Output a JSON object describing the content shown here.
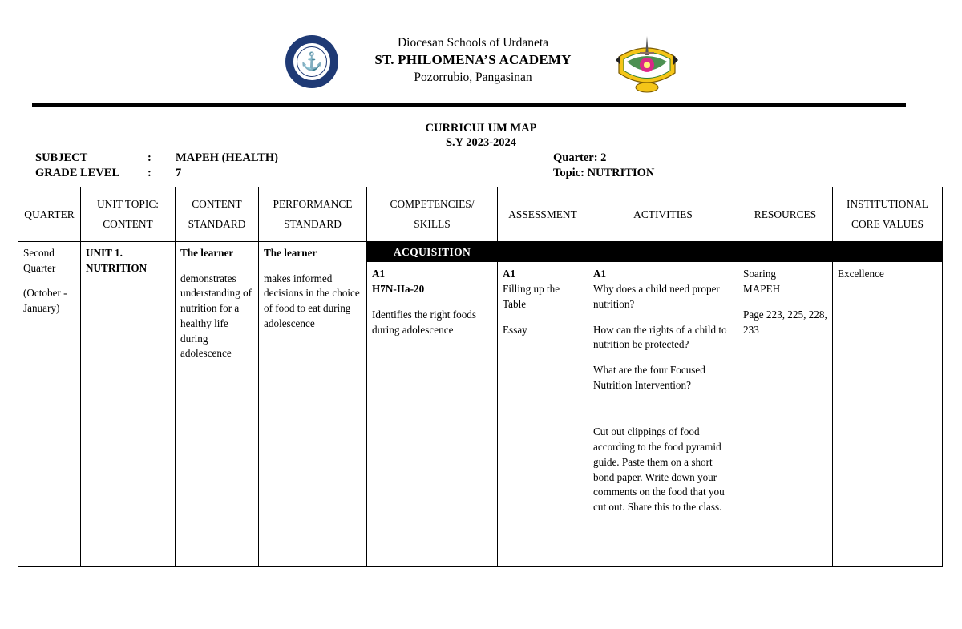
{
  "letterhead": {
    "line1": "Diocesan Schools of Urdaneta",
    "line2": "ST. PHILOMENA’S ACADEMY",
    "line3": "Pozorrubio, Pangasinan",
    "left_seal_name": "st-philomenas-academy-seal",
    "right_seal_name": "diocesan-schools-of-urdaneta-seal"
  },
  "title": {
    "line1": "CURRICULUM MAP",
    "line2": "S.Y 2023-2024"
  },
  "meta": {
    "subject_label": "SUBJECT",
    "subject_colon": ":",
    "subject_value": "MAPEH (HEALTH)",
    "grade_label": "GRADE LEVEL",
    "grade_colon": ":",
    "grade_value": "7",
    "quarter": "Quarter: 2",
    "topic": "Topic: NUTRITION"
  },
  "table": {
    "headers": [
      {
        "top": "QUARTER",
        "bottom": ""
      },
      {
        "top": "UNIT TOPIC:",
        "bottom": "CONTENT"
      },
      {
        "top": "CONTENT",
        "bottom": "STANDARD"
      },
      {
        "top": "PERFORMANCE",
        "bottom": "STANDARD"
      },
      {
        "top": "COMPETENCIES/",
        "bottom": "SKILLS"
      },
      {
        "top": "ASSESSMENT",
        "bottom": ""
      },
      {
        "top": "ACTIVITIES",
        "bottom": ""
      },
      {
        "top": "RESOURCES",
        "bottom": ""
      },
      {
        "top": "INSTITUTIONAL",
        "bottom": "CORE VALUES"
      }
    ],
    "band_label": "ACQUISITION",
    "row": {
      "quarter_line1": "Second",
      "quarter_line2": "Quarter",
      "quarter_line3": "(October -",
      "quarter_line4": "January)",
      "unit_line1": "UNIT 1.",
      "unit_line2": "NUTRITION",
      "content_standard_head": "The learner",
      "content_standard_body": "demonstrates understanding of nutrition for a healthy life during adolescence",
      "performance_standard_head": "The learner",
      "performance_standard_body": "makes informed decisions in the choice of food to eat during adolescence",
      "competency_code1": "A1",
      "competency_code2": "H7N-IIa-20",
      "competency_body": "Identifies the right foods during adolescence",
      "assessment_code": "A1",
      "assessment_item1": "Filling up the Table",
      "assessment_item2": "Essay",
      "activities_code": "A1",
      "activities_q1": "Why does a child need proper nutrition?",
      "activities_q2": "How can the rights of a child to nutrition be protected?",
      "activities_q3": "What are the four Focused Nutrition Intervention?",
      "activities_task": "Cut out clippings of food according to the food pyramid guide. Paste them on a short bond paper. Write down your comments on the food that you cut out. Share this to the class.",
      "resources_line1": "Soaring",
      "resources_line2": "MAPEH",
      "resources_pages": "Page 223, 225, 228, 233",
      "core_value": "Excellence"
    }
  }
}
